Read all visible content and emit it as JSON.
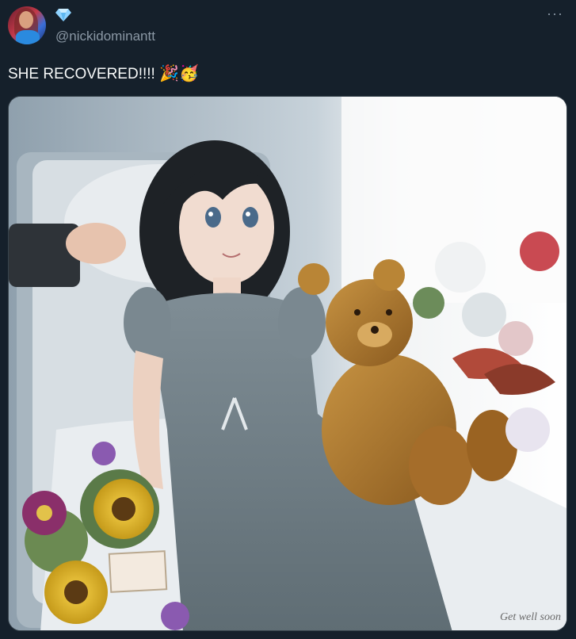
{
  "tweet": {
    "handle": "@nickidominantt",
    "verified_badge_icon": "diamond-icon",
    "more_icon_text": "···",
    "text": "SHE RECOVERED!!!!",
    "emoji": "🎉🥳",
    "media": {
      "signature_text": "Get well soon"
    }
  },
  "colors": {
    "background": "#15202b",
    "text": "#f7f9f9",
    "secondary_text": "#8b98a5",
    "border": "#38444d",
    "badge": "#8fd3ff"
  }
}
